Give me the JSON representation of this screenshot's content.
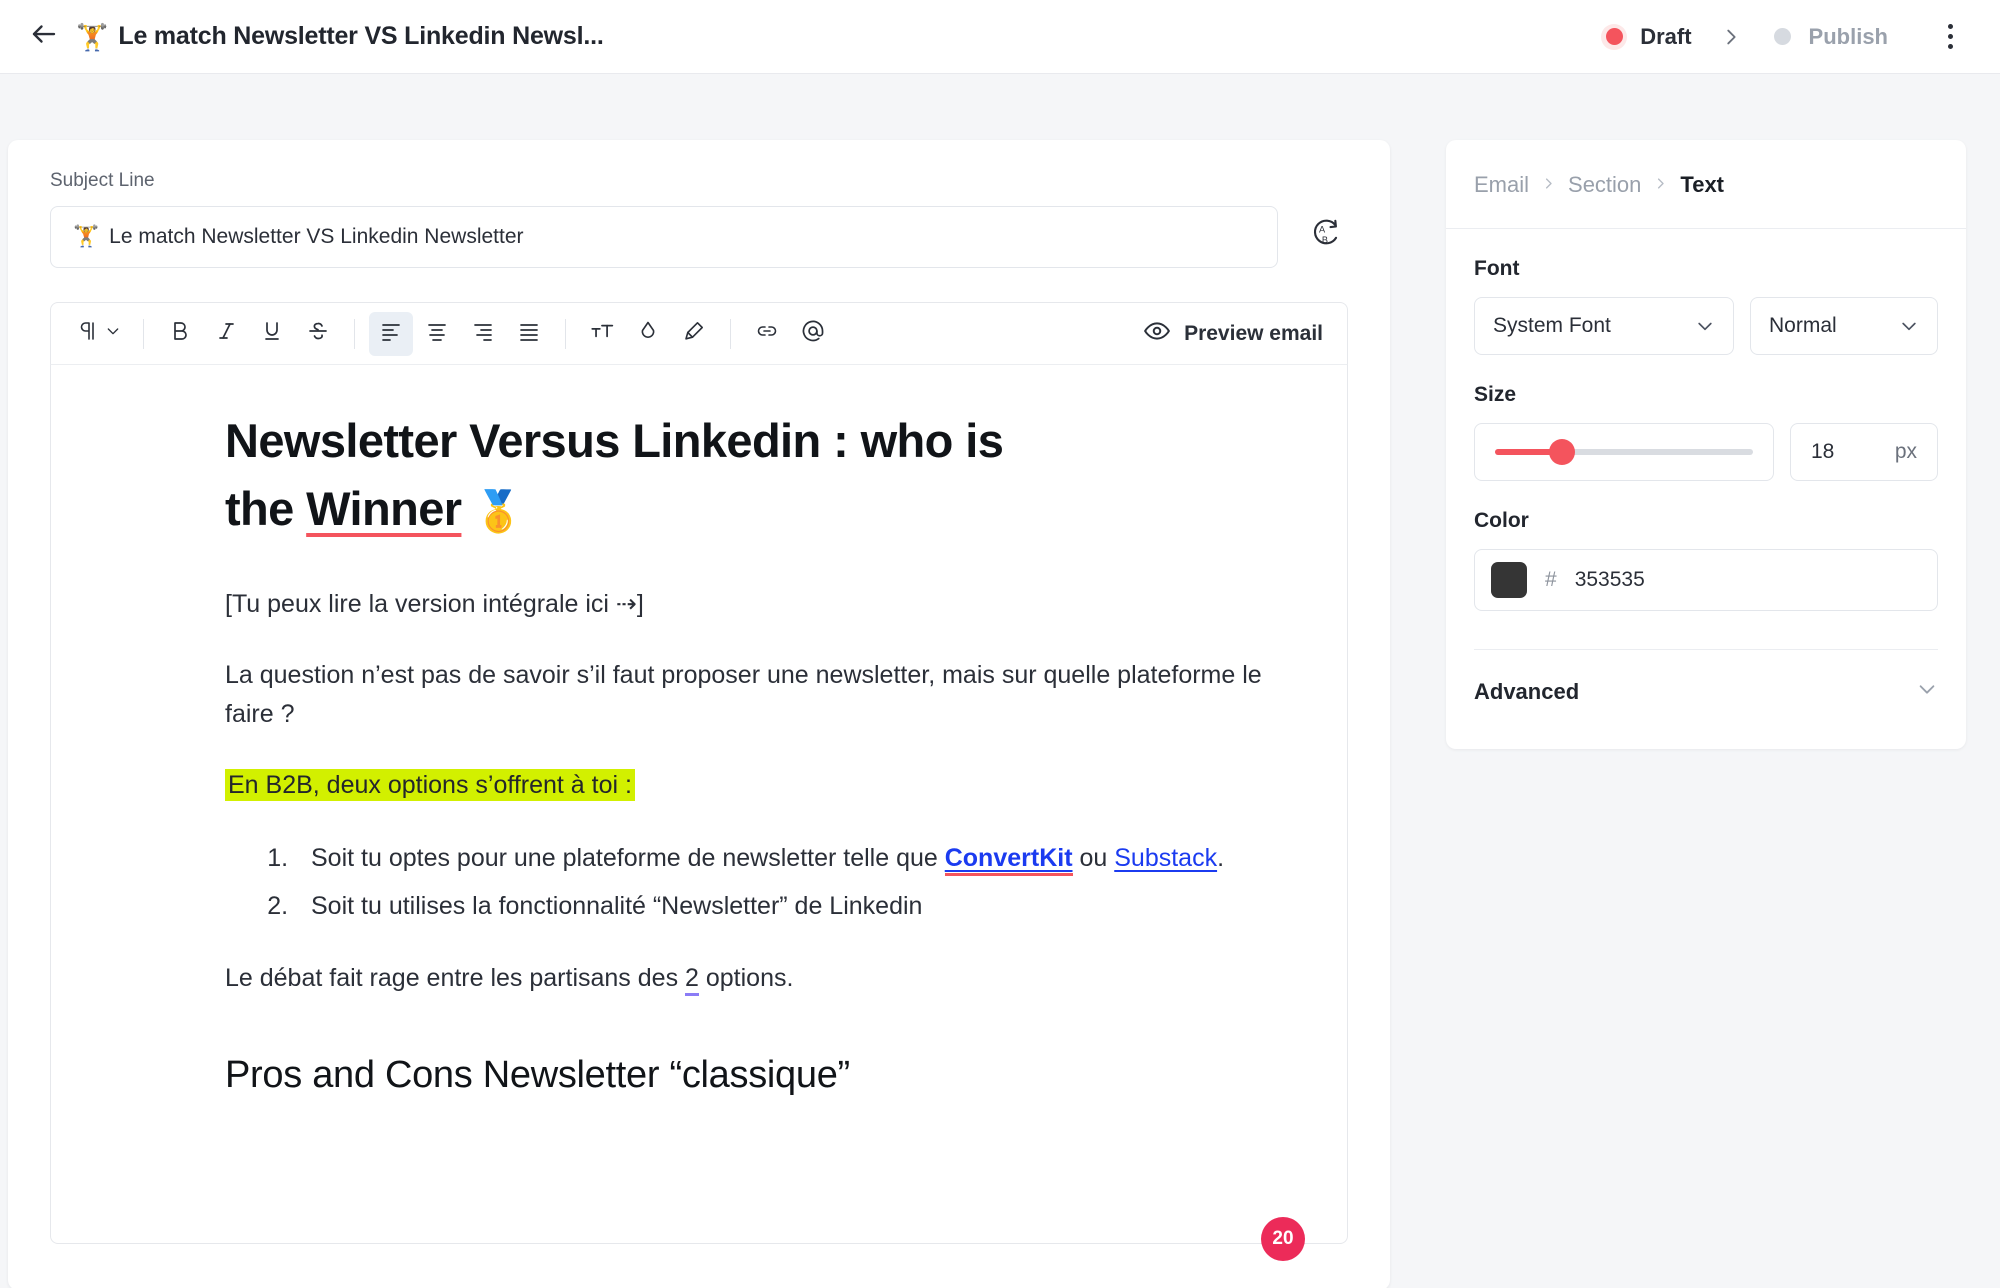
{
  "topbar": {
    "back_icon": "arrow-left-icon",
    "doc_emoji": "🏋️",
    "doc_title": "Le match Newsletter VS Linkedin Newsl...",
    "status_draft": "Draft",
    "status_publish": "Publish",
    "separator": "›",
    "draft_dot_color": "#f4545d",
    "publish_dot_color": "#d6dae0",
    "menu_icon": "kebab-menu-icon"
  },
  "subject": {
    "label": "Subject Line",
    "emoji": "🏋️",
    "value": "Le match Newsletter VS Linkedin Newsletter",
    "placeholder": "Subject Line",
    "regenerate_icon": "ai-rewrite-icon"
  },
  "toolbar": {
    "paragraph_icon": "pilcrow-icon",
    "paragraph_chevron_icon": "chevron-down-icon",
    "bold_icon": "bold-icon",
    "italic_icon": "italic-icon",
    "underline_icon": "underline-icon",
    "strike_icon": "strikethrough-icon",
    "align_left_icon": "align-left-icon",
    "align_center_icon": "align-center-icon",
    "align_right_icon": "align-right-icon",
    "align_justify_icon": "align-justify-icon",
    "font_size_icon": "font-size-icon",
    "text_color_icon": "color-drop-icon",
    "highlight_icon": "highlighter-icon",
    "link_icon": "link-icon",
    "mention_icon": "at-mention-icon",
    "preview_icon": "eye-icon",
    "preview_label": "Preview email",
    "active_tool": "align-left-icon"
  },
  "email": {
    "heading": {
      "line1": "Newsletter Versus Linkedin : who is",
      "line2_pre": "the ",
      "line2_underlined": "Winner",
      "emoji": "🥇"
    },
    "intro": "[Tu peux lire la version intégrale ici ⇢]",
    "paragraph1": "La question n’est pas de savoir s’il faut proposer une newsletter, mais sur quelle plateforme le faire ?",
    "highlighted": "En B2B, deux options s’offrent à toi :",
    "list": [
      {
        "pre": "Soit tu optes pour une plateforme de newsletter telle que ",
        "link1": "ConvertKit",
        "mid": " ou ",
        "link2": "Substack",
        "post": "."
      },
      {
        "text": "Soit tu utilises la fonctionnalité “Newsletter” de Linkedin"
      }
    ],
    "paragraph2_pre": "Le débat fait rage entre les partisans des ",
    "paragraph2_number": "2",
    "paragraph2_post": " options.",
    "subheading": "Pros and Cons Newsletter “classique”",
    "badge_count": "20",
    "highlight_color": "#d2f000",
    "link_color": "#1b3bf0",
    "badge_color": "#ec2b59"
  },
  "panel": {
    "breadcrumb": {
      "level1": "Email",
      "level2": "Section",
      "level3": "Text",
      "separator": "›"
    },
    "font": {
      "label": "Font",
      "family_value": "System Font",
      "weight_value": "Normal",
      "chevron_icon": "chevron-down-icon"
    },
    "size": {
      "label": "Size",
      "value": "18",
      "unit": "px",
      "slider_percent": 26,
      "accent": "#f4545d"
    },
    "color": {
      "label": "Color",
      "hash": "#",
      "value": "353535",
      "swatch": "#353535"
    },
    "advanced": {
      "label": "Advanced",
      "chevron_icon": "chevron-down-icon"
    }
  }
}
